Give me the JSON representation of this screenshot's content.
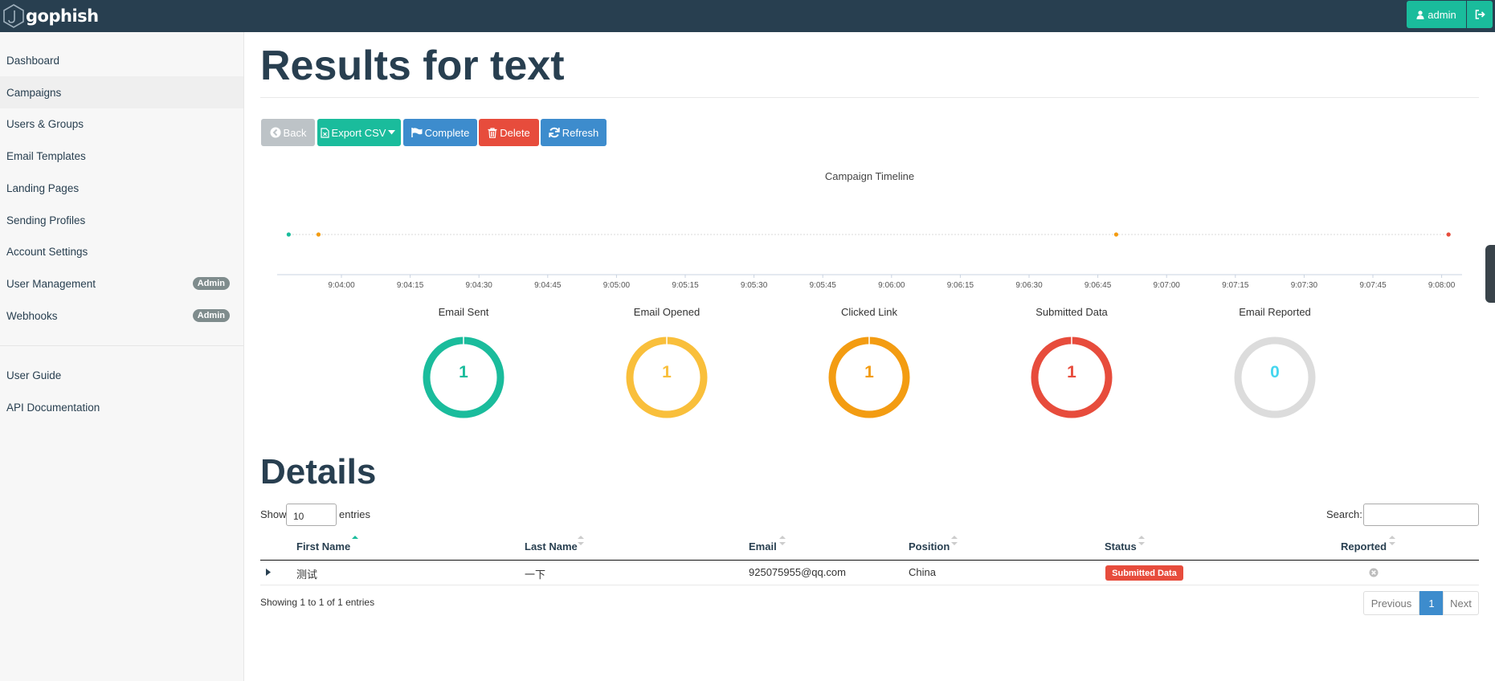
{
  "brand": {
    "name": "gophish"
  },
  "navbar": {
    "user_label": "admin"
  },
  "sidebar": {
    "items": [
      {
        "label": "Dashboard"
      },
      {
        "label": "Campaigns"
      },
      {
        "label": "Users & Groups"
      },
      {
        "label": "Email Templates"
      },
      {
        "label": "Landing Pages"
      },
      {
        "label": "Sending Profiles"
      },
      {
        "label": "Account Settings"
      },
      {
        "label": "User Management",
        "badge": "Admin"
      },
      {
        "label": "Webhooks",
        "badge": "Admin"
      }
    ],
    "bottom_items": [
      {
        "label": "User Guide"
      },
      {
        "label": "API Documentation"
      }
    ]
  },
  "page": {
    "title": "Results for text"
  },
  "toolbar": {
    "back_label": "Back",
    "export_label": "Export CSV",
    "complete_label": "Complete",
    "delete_label": "Delete",
    "refresh_label": "Refresh"
  },
  "timeline": {
    "title": "Campaign Timeline",
    "ticks": [
      "9:04:00",
      "9:04:15",
      "9:04:30",
      "9:04:45",
      "9:05:00",
      "9:05:15",
      "9:05:30",
      "9:05:45",
      "9:06:00",
      "9:06:15",
      "9:06:30",
      "9:06:45",
      "9:07:00",
      "9:07:15",
      "9:07:30",
      "9:07:45",
      "9:08:00"
    ],
    "events": [
      {
        "time_s": -11.5,
        "color": "#1abc9c"
      },
      {
        "time_s": -5,
        "color": "#f39c12"
      },
      {
        "time_s": 169,
        "color": "#f39c12"
      },
      {
        "time_s": 241.5,
        "color": "#e74c3c"
      }
    ]
  },
  "stats": [
    {
      "label": "Email Sent",
      "value": "1",
      "color": "#1abc9c"
    },
    {
      "label": "Email Opened",
      "value": "1",
      "color": "#f9bf3b"
    },
    {
      "label": "Clicked Link",
      "value": "1",
      "color": "#f39c12"
    },
    {
      "label": "Submitted Data",
      "value": "1",
      "color": "#e74c3c"
    },
    {
      "label": "Email Reported",
      "value": "0",
      "color": "#45d6ef"
    }
  ],
  "details": {
    "title": "Details",
    "show_label": "Show",
    "page_length": "10",
    "entries_label": "entries",
    "search_label": "Search:",
    "columns": [
      "First Name",
      "Last Name",
      "Email",
      "Position",
      "Status",
      "Reported"
    ],
    "rows": [
      {
        "first_name": "测试",
        "last_name": "一下",
        "email": "925075955@qq.com",
        "position": "China",
        "status": "Submitted Data"
      }
    ],
    "info": "Showing 1 to 1 of 1 entries",
    "pagination": {
      "previous": "Previous",
      "current": "1",
      "next": "Next"
    }
  }
}
